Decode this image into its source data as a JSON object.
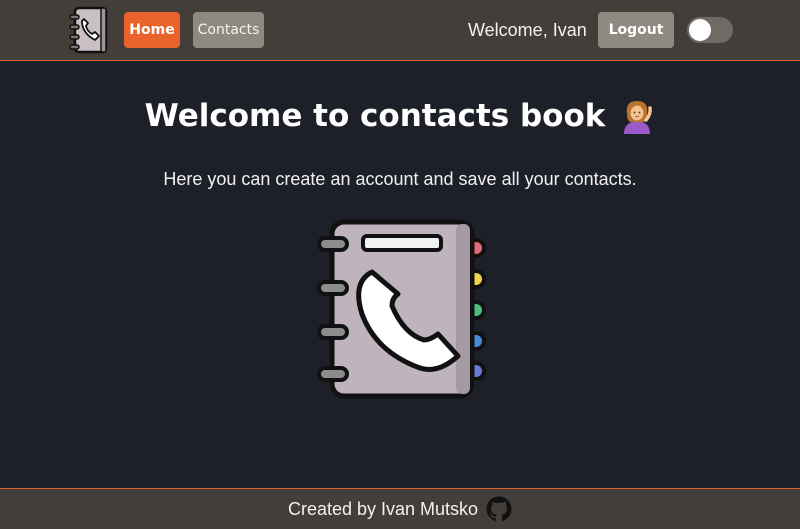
{
  "header": {
    "nav": {
      "home_label": "Home",
      "contacts_label": "Contacts"
    },
    "welcome_text": "Welcome, Ivan",
    "logout_label": "Logout",
    "theme_toggle": {
      "on": false
    }
  },
  "main": {
    "title": "Welcome to contacts book",
    "title_emoji": "woman-tipping-hand-emoji",
    "subtitle": "Here you can create an account and save all your contacts.",
    "hero_image": "phone-book-icon"
  },
  "footer": {
    "text": "Created by Ivan Mutsko",
    "link_icon": "github-icon"
  },
  "colors": {
    "background": "#1d2029",
    "header_bg": "#433e3a",
    "accent": "#e8642c",
    "button_muted": "#8e8a80"
  }
}
